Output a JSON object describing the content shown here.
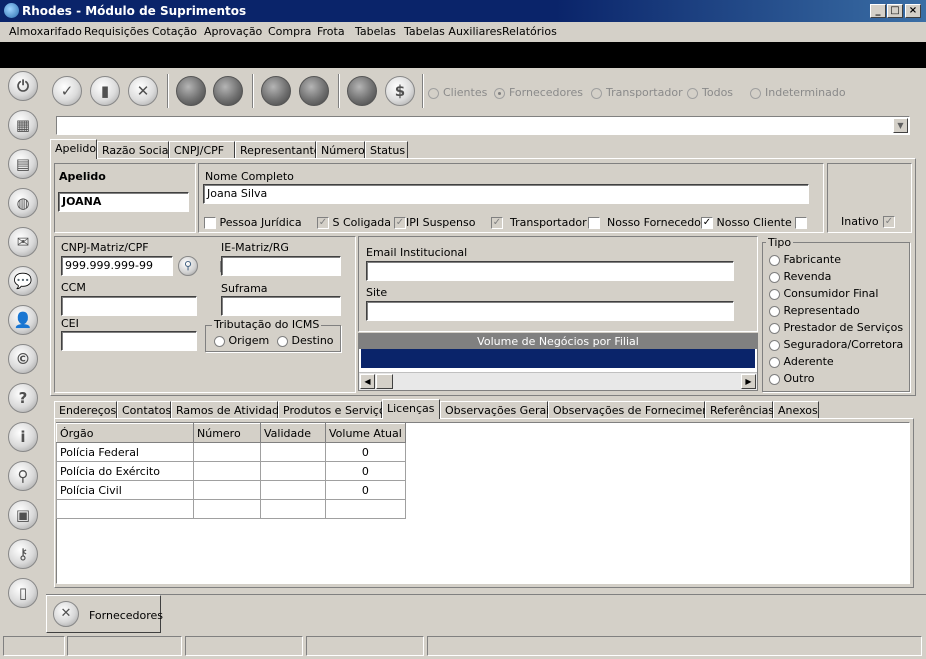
{
  "window": {
    "title": "Rhodes - Módulo de Suprimentos",
    "minimize": "_",
    "maximize": "□",
    "close": "×"
  },
  "menu": [
    "Almoxarifado",
    "Requisições",
    "Cotação",
    "Aprovação",
    "Compra",
    "Frota",
    "Tabelas",
    "Tabelas Auxiliares",
    "Relatórios"
  ],
  "toolbar": {
    "radios": [
      {
        "label": "Clientes",
        "selected": false
      },
      {
        "label": "Fornecedores",
        "selected": true
      },
      {
        "label": "Transportador",
        "selected": false
      },
      {
        "label": "Todos",
        "selected": false
      },
      {
        "label": "Indeterminado",
        "selected": false
      }
    ],
    "check_glyph": "✓",
    "new_glyph": "▮",
    "cancel_glyph": "✕",
    "money_glyph": "$"
  },
  "left_icons": [
    "power-icon",
    "calculator-icon",
    "grid-icon",
    "globe-icon",
    "mail-icon",
    "chat-icon",
    "user-icon",
    "copyright-icon",
    "help-icon",
    "info-icon",
    "search-icon",
    "camera-icon",
    "key-icon",
    "battery-icon"
  ],
  "left_glyphs": [
    "⏻",
    "▦",
    "▤",
    "◍",
    "✉",
    "💬",
    "👤",
    "©",
    "?",
    "i",
    "⚲",
    "▣",
    "⚷",
    "▯"
  ],
  "search_tabs": [
    "Apelido",
    "Razão Social",
    "CNPJ/CPF",
    "Representante",
    "Número",
    "Status"
  ],
  "form": {
    "apelido_label": "Apelido",
    "apelido_value": "JOANA",
    "nome_label": "Nome Completo",
    "nome_value": "Joana Silva",
    "checks": [
      {
        "label": "Pessoa Jurídica",
        "checked": false
      },
      {
        "label": "S Coligada",
        "checked": true,
        "disabled": true
      },
      {
        "label": "IPI Suspenso",
        "checked": true,
        "disabled": true
      },
      {
        "label": "Transportador",
        "checked": true,
        "disabled": true
      },
      {
        "label": "Nosso Fornecedor",
        "checked": false
      },
      {
        "label": "Nosso Cliente",
        "checked": true
      }
    ],
    "nosso_cliente_extra": false,
    "inativo_label": "Inativo",
    "cnpj_label": "CNPJ-Matriz/CPF",
    "cnpj_value": "999.999.999-99",
    "ie_label": "IE-Matriz/RG",
    "ccm_label": "CCM",
    "suframa_label": "Suframa",
    "cei_label": "CEI",
    "icms_title": "Tributação do ICMS",
    "icms_options": [
      "Origem",
      "Destino"
    ],
    "email_label": "Email Institucional",
    "site_label": "Site",
    "volume_title": "Volume de Negócios por Filial",
    "tipo_title": "Tipo",
    "tipo_options": [
      "Fabricante",
      "Revenda",
      "Consumidor Final",
      "Representado",
      "Prestador de Serviços",
      "Seguradora/Corretora",
      "Aderente",
      "Outro"
    ]
  },
  "detail_tabs": [
    "Endereços",
    "Contatos",
    "Ramos de Atividade",
    "Produtos e Serviços",
    "Licenças",
    "Observações Gerais",
    "Observações de Fornecimento",
    "Referências",
    "Anexos"
  ],
  "licencas": {
    "columns": [
      "Órgão",
      "Número",
      "Validade",
      "Volume Atual"
    ],
    "rows": [
      {
        "orgao": "Polícia Federal",
        "numero": "",
        "validade": "",
        "volume": "0"
      },
      {
        "orgao": "Polícia do Exército",
        "numero": "",
        "validade": "",
        "volume": "0"
      },
      {
        "orgao": "Polícia Civil",
        "numero": "",
        "validade": "",
        "volume": "0"
      }
    ]
  },
  "bottom_tab": {
    "label": "Fornecedores",
    "close_glyph": "✕"
  }
}
